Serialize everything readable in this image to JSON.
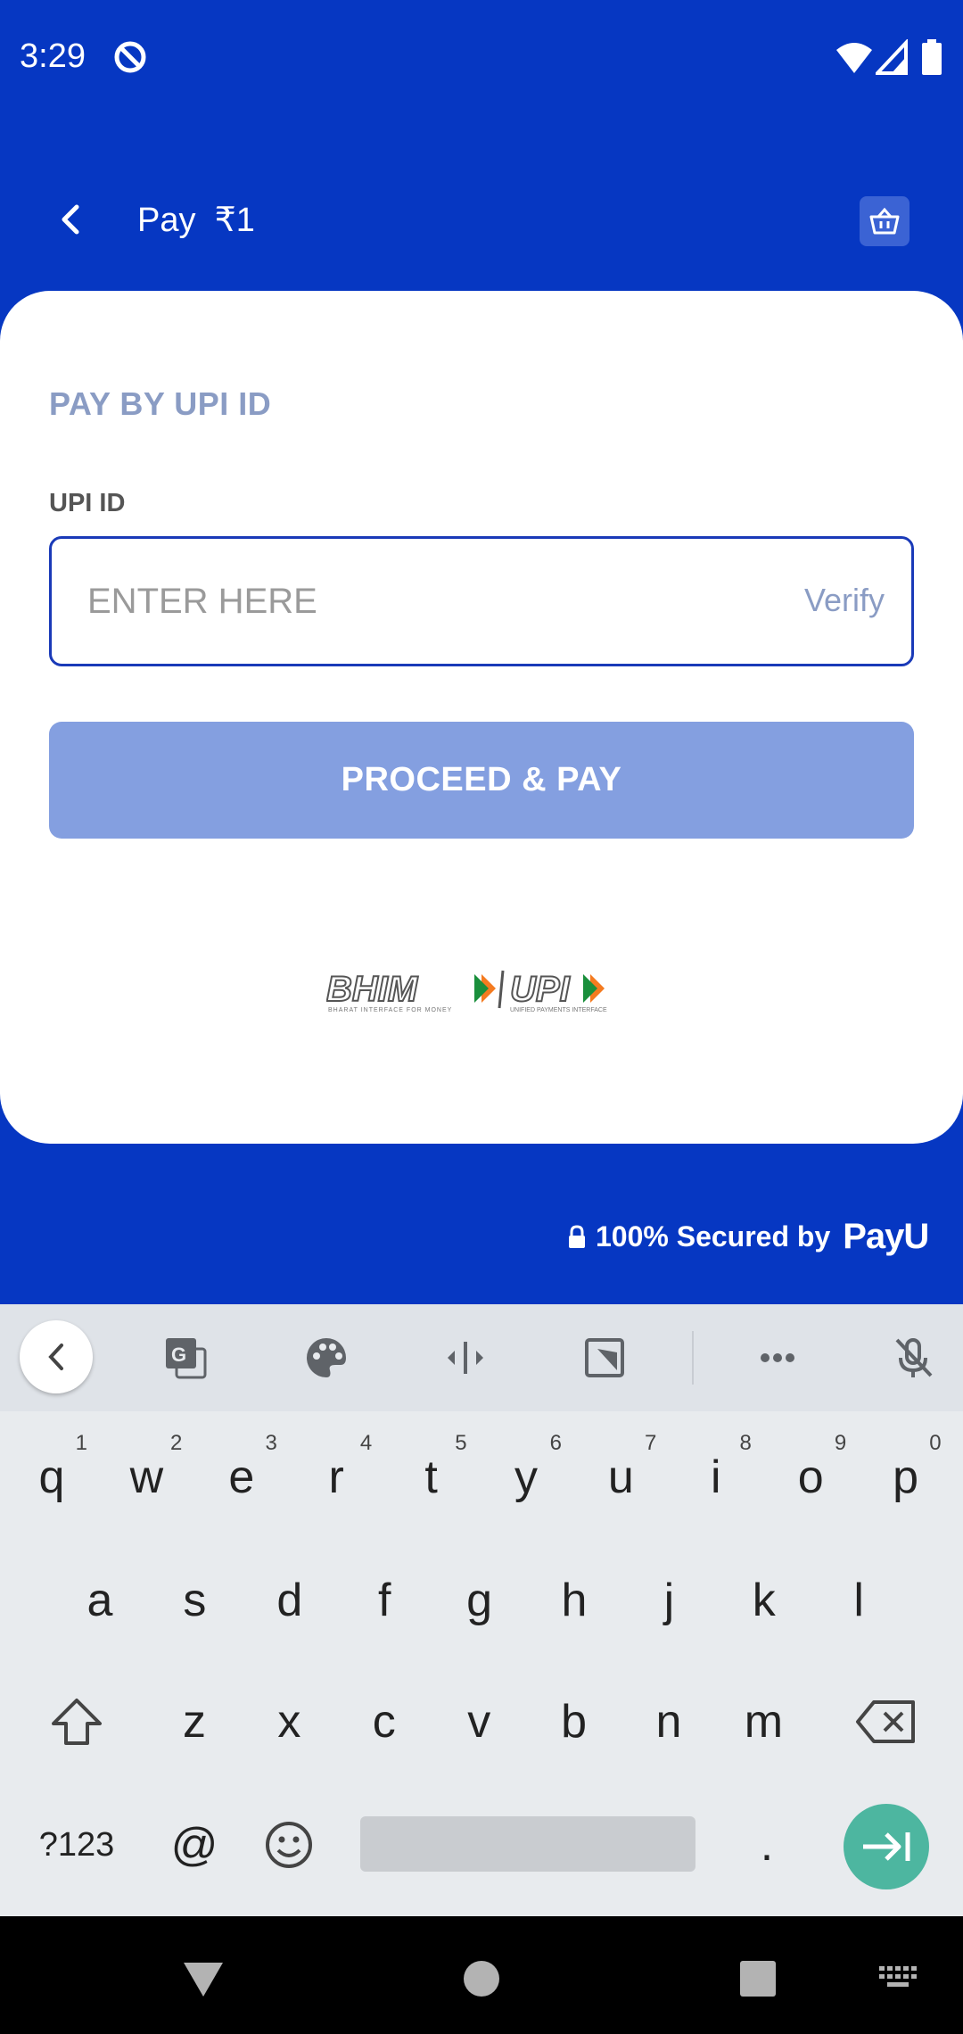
{
  "status_bar": {
    "time": "3:29"
  },
  "app_bar": {
    "title": "Pay  ₹1"
  },
  "card": {
    "section_title": "PAY BY UPI ID",
    "field_label": "UPI ID",
    "input_placeholder": "ENTER HERE",
    "input_value": "",
    "verify_label": "Verify",
    "proceed_label": "PROCEED & PAY",
    "logo_text": "BHIM UPI"
  },
  "footer": {
    "secured_text": "100% Secured by",
    "brand": "PayU"
  },
  "keyboard": {
    "row1": [
      {
        "k": "q",
        "n": "1"
      },
      {
        "k": "w",
        "n": "2"
      },
      {
        "k": "e",
        "n": "3"
      },
      {
        "k": "r",
        "n": "4"
      },
      {
        "k": "t",
        "n": "5"
      },
      {
        "k": "y",
        "n": "6"
      },
      {
        "k": "u",
        "n": "7"
      },
      {
        "k": "i",
        "n": "8"
      },
      {
        "k": "o",
        "n": "9"
      },
      {
        "k": "p",
        "n": "0"
      }
    ],
    "row2": [
      "a",
      "s",
      "d",
      "f",
      "g",
      "h",
      "j",
      "k",
      "l"
    ],
    "row3": [
      "z",
      "x",
      "c",
      "v",
      "b",
      "n",
      "m"
    ],
    "symbols_label": "?123",
    "at_label": "@",
    "period_label": "."
  },
  "colors": {
    "brand_blue": "#0637c2",
    "button_disabled": "#849fe0",
    "enter_key": "#4db6a0"
  }
}
